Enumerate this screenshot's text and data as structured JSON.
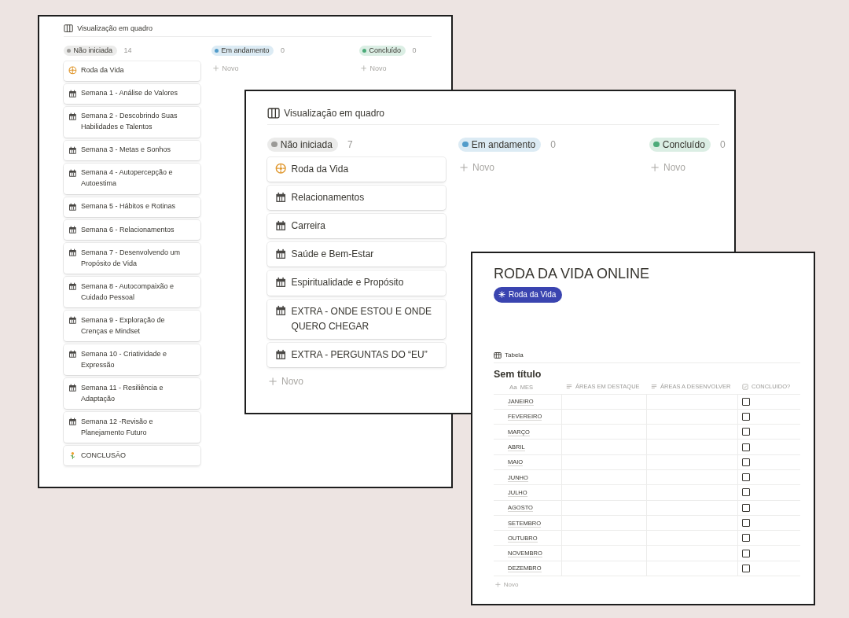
{
  "windows": [
    {
      "kind": "board",
      "view_title": "Visualização em quadro",
      "columns": [
        {
          "label": "Não iniciada",
          "color": "#9b9a97",
          "count": "14",
          "cards": [
            {
              "kind": "wheel",
              "title": "Roda da Vida"
            },
            {
              "kind": "calendar",
              "title": "Semana 1 - Análise de Valores"
            },
            {
              "kind": "calendar",
              "title": "Semana 2 - Descobrindo Suas Habilidades e Talentos"
            },
            {
              "kind": "calendar",
              "title": "Semana 3 - Metas e Sonhos"
            },
            {
              "kind": "calendar",
              "title": "Semana 4 - Autopercepção e Autoestima"
            },
            {
              "kind": "calendar",
              "title": "Semana 5 - Hábitos e Rotinas"
            },
            {
              "kind": "calendar",
              "title": "Semana 6 - Relacionamentos"
            },
            {
              "kind": "calendar",
              "title": "Semana 7 - Desenvolvendo um Propósito de Vida"
            },
            {
              "kind": "calendar",
              "title": "Semana 8 - Autocompaixão e Cuidado Pessoal"
            },
            {
              "kind": "calendar",
              "title": "Semana 9 - Exploração de Crenças e Mindset"
            },
            {
              "kind": "calendar",
              "title": "Semana 10 - Criatividade e Expressão"
            },
            {
              "kind": "calendar",
              "title": "Semana 11 - Resiliência e Adaptação"
            },
            {
              "kind": "calendar",
              "title": "Semana 12 -Revisão e Planejamento Futuro"
            },
            {
              "kind": "plant",
              "title": "CONCLUSÃO"
            }
          ]
        },
        {
          "label": "Em andamento",
          "color": "#529cca",
          "count": "0",
          "new_label": "Novo"
        },
        {
          "label": "Concluído",
          "color": "#4dab7a",
          "count": "0",
          "new_label": "Novo"
        }
      ]
    },
    {
      "kind": "board",
      "view_title": "Visualização em quadro",
      "columns": [
        {
          "label": "Não iniciada",
          "color": "#9b9a97",
          "count": "7",
          "cards": [
            {
              "kind": "wheel",
              "title": "Roda da Vida"
            },
            {
              "kind": "calendar",
              "title": "Relacionamentos"
            },
            {
              "kind": "calendar",
              "title": "Carreira"
            },
            {
              "kind": "calendar",
              "title": "Saúde e Bem-Estar"
            },
            {
              "kind": "calendar",
              "title": "Espiritualidade e Propósito"
            },
            {
              "kind": "calendar",
              "title": "EXTRA - ONDE ESTOU E ONDE QUERO CHEGAR"
            },
            {
              "kind": "calendar",
              "title": "EXTRA - PERGUNTAS DO “EU”"
            }
          ],
          "new_label": "Novo"
        },
        {
          "label": "Em andamento",
          "color": "#529cca",
          "count": "0",
          "new_label": "Novo"
        },
        {
          "label": "Concluído",
          "color": "#4dab7a",
          "count": "0",
          "new_label": "Novo"
        }
      ]
    },
    {
      "kind": "table_page",
      "title": "RODA DA VIDA ONLINE",
      "tag": "Roda da Vida",
      "view": "Tabela",
      "table_title": "Sem título",
      "columns": [
        {
          "kind": "title",
          "prefix": "Aa",
          "label": "MES"
        },
        {
          "kind": "text",
          "label": "ÁREAS EM DESTAQUE"
        },
        {
          "kind": "text",
          "label": "ÁREAS A DESENVOLVER"
        },
        {
          "kind": "checkbox",
          "label": "CONCLUIDO?"
        }
      ],
      "rows": [
        {
          "month": "JANEIRO",
          "checked": false
        },
        {
          "month": "FEVEREIRO",
          "checked": false
        },
        {
          "month": "MARÇO",
          "checked": false
        },
        {
          "month": "ABRIL",
          "checked": false
        },
        {
          "month": "MAIO",
          "checked": false
        },
        {
          "month": "JUNHO",
          "checked": false
        },
        {
          "month": "JULHO",
          "checked": false
        },
        {
          "month": "AGOSTO",
          "checked": false
        },
        {
          "month": "SETEMBRO",
          "checked": false
        },
        {
          "month": "OUTUBRO",
          "checked": false
        },
        {
          "month": "NOVEMBRO",
          "checked": false
        },
        {
          "month": "DEZEMBRO",
          "checked": false
        }
      ],
      "new_label": "Novo"
    }
  ]
}
